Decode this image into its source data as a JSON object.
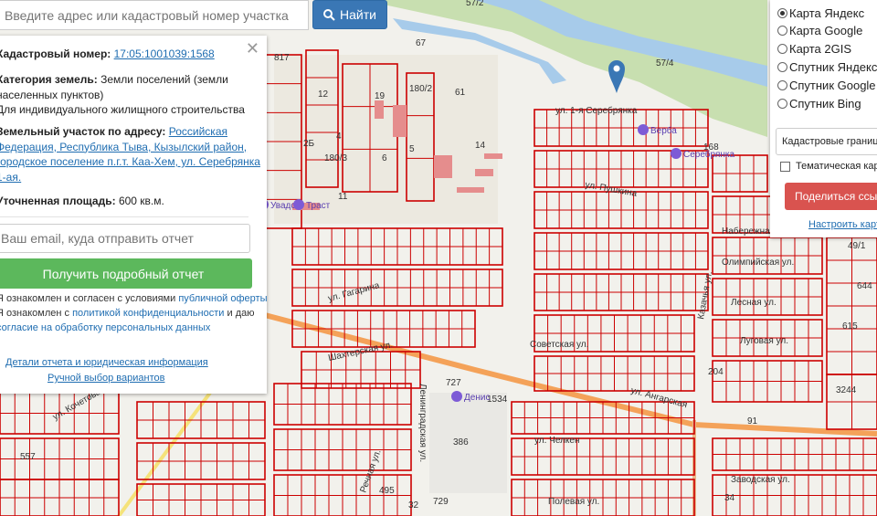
{
  "search": {
    "placeholder": "Введите адрес или кадастровый номер участка",
    "button_label": "Найти",
    "button_icon": "search-icon"
  },
  "info": {
    "cadastral_label": "Кадастровый номер:",
    "cadastral_number": "17:05:1001039:1568",
    "category_label": "Категория земель:",
    "category_value_1": "Земли поселений (земли",
    "category_value_2": "населенных пунктов)",
    "category_value_3": "Для индивидуального жилищного строительства",
    "address_label": "Земельный участок по адресу:",
    "address_1": "Российская",
    "address_2": "Федерация, Республика Тыва, Кызылский район,",
    "address_3": "городское поселение п.г.т. Каа-Хем, ул. Серебрянка 1-ая.",
    "area_label": "Уточненная площадь:",
    "area_value": "600 кв.м.",
    "email_placeholder": "Ваш email, куда отправить отчет",
    "report_button": "Получить подробный отчет",
    "consent_1a": "Я ознакомлен и согласен с условиями ",
    "consent_1b": "публичной оферты",
    "consent_2a": "Я ознакомлен с ",
    "consent_2b": "политикой конфиденциальности",
    "consent_2c": " и даю",
    "consent_3": "согласие на обработку персональных данных",
    "details_link": "Детали отчета и юридическая информация",
    "manual_link": "Ручной выбор вариантов"
  },
  "layers": {
    "options": [
      "Карта Яндекс",
      "Карта Google",
      "Карта 2GIS",
      "Спутник Яндекс",
      "Спутник Google",
      "Спутник Bing"
    ],
    "selected": 0,
    "select_value": "Кадастровые границы",
    "thematic_label": "Тематическая карта",
    "share_button": "Поделиться ссылкой",
    "setup_link": "Настроить карту"
  },
  "map": {
    "street_labels": [
      "ул. 1-я Серебрянка",
      "Шахтерская ул.",
      "ул. Кочетова",
      "Казачья ул.",
      "Олимпийская ул.",
      "Лесная ул.",
      "Луговая ул.",
      "Заводская ул.",
      "Набережная ул.",
      "Советская ул.",
      "ул. Гагарина",
      "Ленинградская ул.",
      "ул. Челкен",
      "ул. Пушкина",
      "ул. Ангарская",
      "Речная ул.",
      "Полевая ул."
    ],
    "parcel_numbers": [
      "817",
      "67",
      "57/2",
      "57/4",
      "61",
      "12",
      "19",
      "180/2",
      "14",
      "11",
      "6",
      "5",
      "4",
      "180/3",
      "2Б",
      "49/1",
      "644",
      "615",
      "3244",
      "386",
      "557",
      "495",
      "729",
      "727",
      "1534",
      "168",
      "204",
      "91",
      "32",
      "34"
    ],
    "poi_labels": [
      "Верба",
      "Серебрянка",
      "Увадс",
      "Денис",
      "Траст"
    ],
    "colors": {
      "parcel": "#cc0000",
      "river": "#a7cbea",
      "forest": "#c8dfb0",
      "road": "#f4a259",
      "sand": "#efe6c6"
    }
  }
}
